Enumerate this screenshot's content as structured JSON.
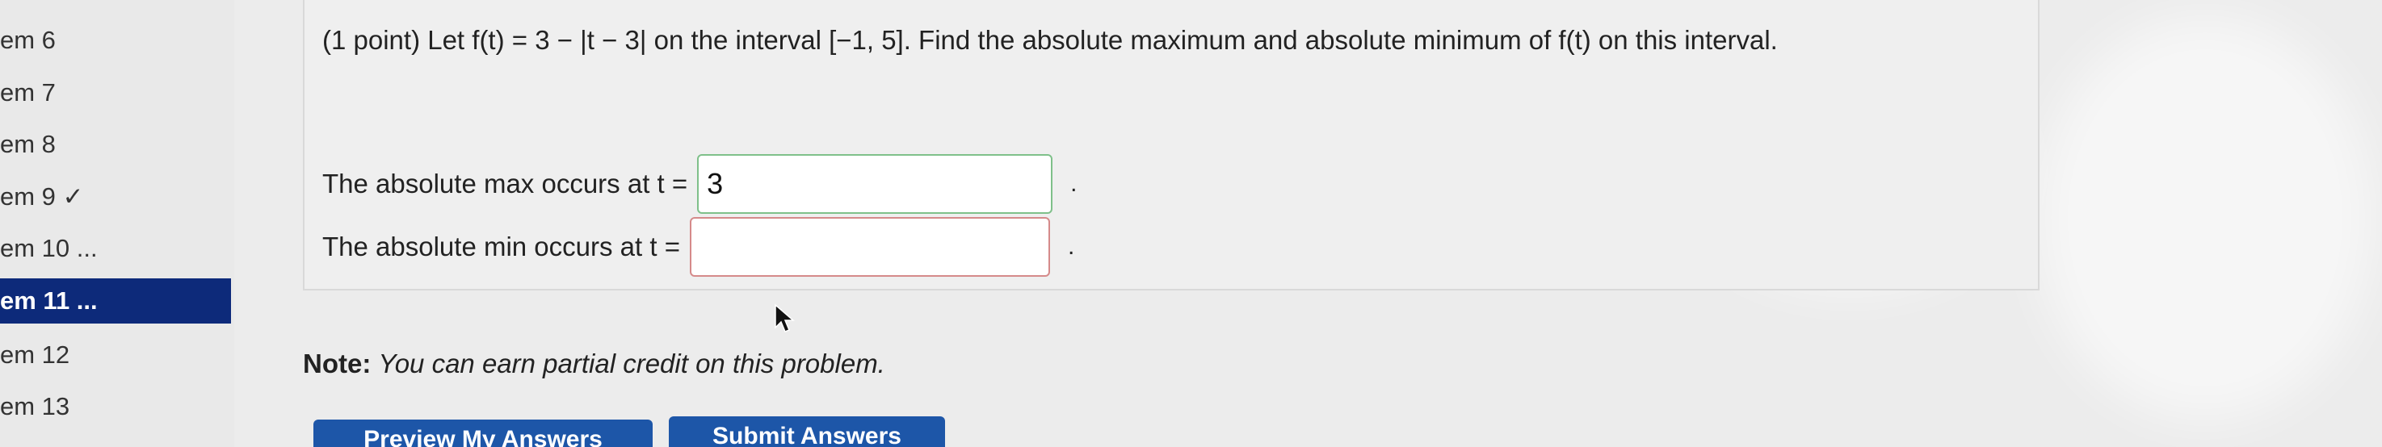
{
  "sidebar": {
    "items": [
      {
        "label": "em 6",
        "active": false
      },
      {
        "label": "em 7",
        "active": false
      },
      {
        "label": "em 8",
        "active": false
      },
      {
        "label": "em 9 ✓",
        "active": false
      },
      {
        "label": "em 10 ...",
        "active": false
      },
      {
        "label": "em 11 ...",
        "active": true
      },
      {
        "label": "em 12",
        "active": false
      },
      {
        "label": "em 13",
        "active": false
      }
    ]
  },
  "problem": {
    "statement": "(1 point) Let f(t) = 3 − |t − 3| on the interval [−1, 5]. Find the absolute maximum and absolute minimum of f(t) on this interval.",
    "max_label": "The absolute max occurs at t =",
    "max_value": "3",
    "min_label": "The absolute min occurs at t =",
    "min_value": "",
    "period": "."
  },
  "note": {
    "prefix": "Note:",
    "text": "You can earn partial credit on this problem."
  },
  "buttons": {
    "preview": "Preview My Answers",
    "submit": "Submit Answers"
  },
  "colors": {
    "sidebar_active_bg": "#0d2a7a",
    "button_bg": "#1d56a8",
    "correct_border": "#7fc08a",
    "incorrect_border": "#d58a8a"
  }
}
